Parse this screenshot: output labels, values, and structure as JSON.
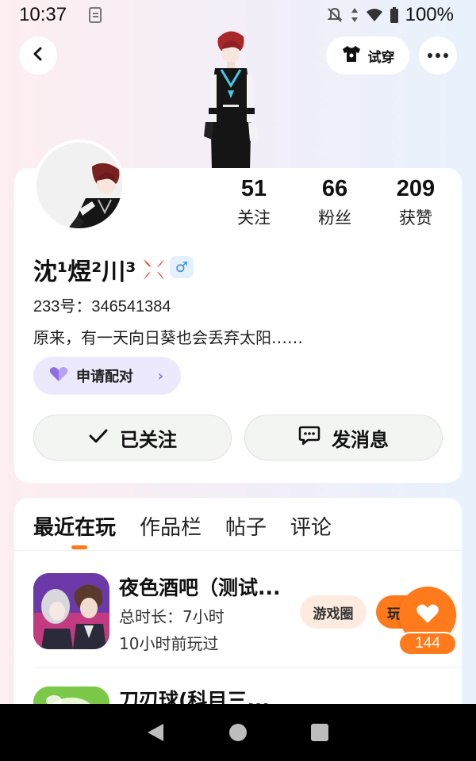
{
  "status_bar": {
    "time": "10:37",
    "battery": "100%"
  },
  "header": {
    "try_on_label": "试穿"
  },
  "profile": {
    "stats": [
      {
        "value": "51",
        "label": "关注"
      },
      {
        "value": "66",
        "label": "粉丝"
      },
      {
        "value": "209",
        "label": "获赞"
      }
    ],
    "username": "沈¹煜²川³",
    "gender": "♂",
    "uid": "233号：346541384",
    "bio": "原来，有一天向日葵也会丢弃太阳……",
    "pair_label": "申请配对",
    "follow_label": "已关注",
    "message_label": "发消息"
  },
  "tabs": [
    {
      "label": "最近在玩",
      "active": true
    },
    {
      "label": "作品栏",
      "active": false
    },
    {
      "label": "帖子",
      "active": false
    },
    {
      "label": "评论",
      "active": false
    }
  ],
  "games": [
    {
      "title": "夜色酒吧（测试...",
      "duration": "总时长：7小时",
      "last_played": "10小时前玩过",
      "circle_label": "游戏圈",
      "play_label": "玩"
    },
    {
      "title": "刀刃球(科目三..."
    }
  ],
  "like_fab": {
    "count": "144"
  },
  "colors": {
    "accent": "#ff7a1a",
    "pair_bg": "#ebe9fb",
    "gender_blue": "#3b8fe6"
  },
  "icons": {
    "back": "chevron-left-icon",
    "try_on": "tshirt-icon",
    "more": "more-dots-icon",
    "pair": "heart-icon",
    "follow": "check-icon",
    "message": "chat-bubble-icon",
    "like": "heart-icon"
  }
}
